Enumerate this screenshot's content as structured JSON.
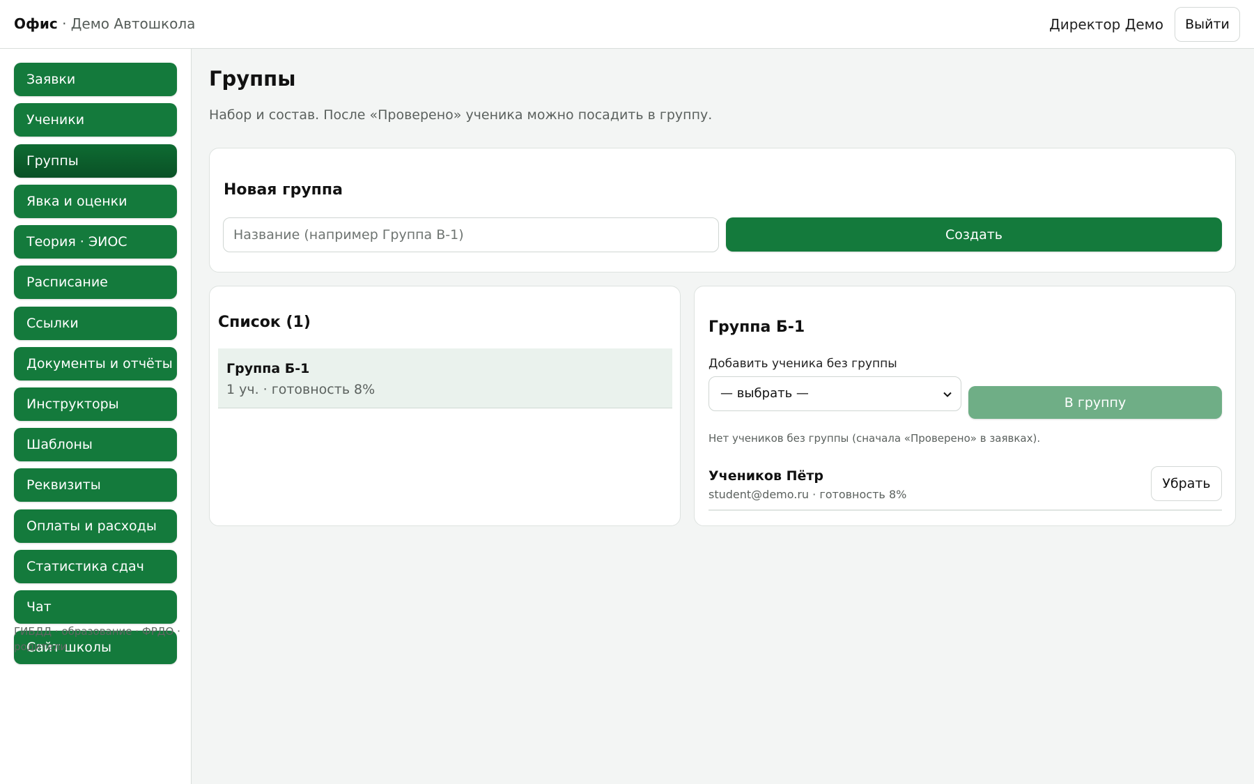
{
  "header": {
    "app_name": "Офис",
    "school_name": " · Демо Автошкола",
    "user_name": "Директор Демо",
    "logout_label": "Выйти"
  },
  "sidebar": {
    "items": [
      {
        "label": "Заявки"
      },
      {
        "label": "Ученики"
      },
      {
        "label": "Группы",
        "active": true
      },
      {
        "label": "Явка и оценки"
      },
      {
        "label": "Теория · ЭИОС"
      },
      {
        "label": "Расписание"
      },
      {
        "label": "Ссылки"
      },
      {
        "label": "Документы и отчёты"
      },
      {
        "label": "Инструкторы"
      },
      {
        "label": "Шаблоны"
      },
      {
        "label": "Реквизиты"
      },
      {
        "label": "Оплаты и расходы"
      },
      {
        "label": "Статистика сдач"
      },
      {
        "label": "Чат"
      },
      {
        "label": "Сайт школы"
      }
    ],
    "footer": "ГИБДД · образование · ФРДО · родители"
  },
  "main": {
    "title": "Группы",
    "subtitle": "Набор и состав. После «Проверено» ученика можно посадить в группу.",
    "new_group": {
      "title": "Новая группа",
      "input_placeholder": "Название (например Группа В-1)",
      "input_value": "",
      "create_label": "Создать"
    },
    "list": {
      "title": "Список (1)",
      "groups": [
        {
          "name": "Группа Б-1",
          "meta": "1 уч. · готовность 8%"
        }
      ]
    },
    "detail": {
      "title": "Группа Б-1",
      "add_label": "Добавить ученика без группы",
      "select_value": "— выбрать —",
      "add_button": "В группу",
      "hint": "Нет учеников без группы (сначала «Проверено» в заявках).",
      "members": [
        {
          "name": "Учеников Пётр",
          "meta": "student@demo.ru · готовность 8%",
          "remove_label": "Убрать"
        }
      ]
    }
  },
  "colors": {
    "accent": "#147a3c",
    "accent_active": "#0a5126",
    "accent_disabled": "#6fae86",
    "page_bg": "#f3f5f4",
    "list_selected_bg": "#eaf2ed"
  }
}
